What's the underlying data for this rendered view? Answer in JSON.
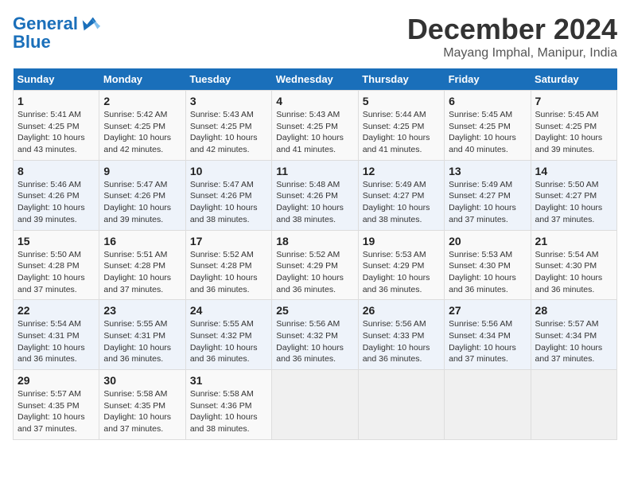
{
  "logo": {
    "line1": "General",
    "line2": "Blue"
  },
  "title": "December 2024",
  "location": "Mayang Imphal, Manipur, India",
  "weekdays": [
    "Sunday",
    "Monday",
    "Tuesday",
    "Wednesday",
    "Thursday",
    "Friday",
    "Saturday"
  ],
  "weeks": [
    [
      {
        "day": "1",
        "sunrise": "5:41 AM",
        "sunset": "4:25 PM",
        "daylight": "10 hours and 43 minutes."
      },
      {
        "day": "2",
        "sunrise": "5:42 AM",
        "sunset": "4:25 PM",
        "daylight": "10 hours and 42 minutes."
      },
      {
        "day": "3",
        "sunrise": "5:43 AM",
        "sunset": "4:25 PM",
        "daylight": "10 hours and 42 minutes."
      },
      {
        "day": "4",
        "sunrise": "5:43 AM",
        "sunset": "4:25 PM",
        "daylight": "10 hours and 41 minutes."
      },
      {
        "day": "5",
        "sunrise": "5:44 AM",
        "sunset": "4:25 PM",
        "daylight": "10 hours and 41 minutes."
      },
      {
        "day": "6",
        "sunrise": "5:45 AM",
        "sunset": "4:25 PM",
        "daylight": "10 hours and 40 minutes."
      },
      {
        "day": "7",
        "sunrise": "5:45 AM",
        "sunset": "4:25 PM",
        "daylight": "10 hours and 39 minutes."
      }
    ],
    [
      {
        "day": "8",
        "sunrise": "5:46 AM",
        "sunset": "4:26 PM",
        "daylight": "10 hours and 39 minutes."
      },
      {
        "day": "9",
        "sunrise": "5:47 AM",
        "sunset": "4:26 PM",
        "daylight": "10 hours and 39 minutes."
      },
      {
        "day": "10",
        "sunrise": "5:47 AM",
        "sunset": "4:26 PM",
        "daylight": "10 hours and 38 minutes."
      },
      {
        "day": "11",
        "sunrise": "5:48 AM",
        "sunset": "4:26 PM",
        "daylight": "10 hours and 38 minutes."
      },
      {
        "day": "12",
        "sunrise": "5:49 AM",
        "sunset": "4:27 PM",
        "daylight": "10 hours and 38 minutes."
      },
      {
        "day": "13",
        "sunrise": "5:49 AM",
        "sunset": "4:27 PM",
        "daylight": "10 hours and 37 minutes."
      },
      {
        "day": "14",
        "sunrise": "5:50 AM",
        "sunset": "4:27 PM",
        "daylight": "10 hours and 37 minutes."
      }
    ],
    [
      {
        "day": "15",
        "sunrise": "5:50 AM",
        "sunset": "4:28 PM",
        "daylight": "10 hours and 37 minutes."
      },
      {
        "day": "16",
        "sunrise": "5:51 AM",
        "sunset": "4:28 PM",
        "daylight": "10 hours and 37 minutes."
      },
      {
        "day": "17",
        "sunrise": "5:52 AM",
        "sunset": "4:28 PM",
        "daylight": "10 hours and 36 minutes."
      },
      {
        "day": "18",
        "sunrise": "5:52 AM",
        "sunset": "4:29 PM",
        "daylight": "10 hours and 36 minutes."
      },
      {
        "day": "19",
        "sunrise": "5:53 AM",
        "sunset": "4:29 PM",
        "daylight": "10 hours and 36 minutes."
      },
      {
        "day": "20",
        "sunrise": "5:53 AM",
        "sunset": "4:30 PM",
        "daylight": "10 hours and 36 minutes."
      },
      {
        "day": "21",
        "sunrise": "5:54 AM",
        "sunset": "4:30 PM",
        "daylight": "10 hours and 36 minutes."
      }
    ],
    [
      {
        "day": "22",
        "sunrise": "5:54 AM",
        "sunset": "4:31 PM",
        "daylight": "10 hours and 36 minutes."
      },
      {
        "day": "23",
        "sunrise": "5:55 AM",
        "sunset": "4:31 PM",
        "daylight": "10 hours and 36 minutes."
      },
      {
        "day": "24",
        "sunrise": "5:55 AM",
        "sunset": "4:32 PM",
        "daylight": "10 hours and 36 minutes."
      },
      {
        "day": "25",
        "sunrise": "5:56 AM",
        "sunset": "4:32 PM",
        "daylight": "10 hours and 36 minutes."
      },
      {
        "day": "26",
        "sunrise": "5:56 AM",
        "sunset": "4:33 PM",
        "daylight": "10 hours and 36 minutes."
      },
      {
        "day": "27",
        "sunrise": "5:56 AM",
        "sunset": "4:34 PM",
        "daylight": "10 hours and 37 minutes."
      },
      {
        "day": "28",
        "sunrise": "5:57 AM",
        "sunset": "4:34 PM",
        "daylight": "10 hours and 37 minutes."
      }
    ],
    [
      {
        "day": "29",
        "sunrise": "5:57 AM",
        "sunset": "4:35 PM",
        "daylight": "10 hours and 37 minutes."
      },
      {
        "day": "30",
        "sunrise": "5:58 AM",
        "sunset": "4:35 PM",
        "daylight": "10 hours and 37 minutes."
      },
      {
        "day": "31",
        "sunrise": "5:58 AM",
        "sunset": "4:36 PM",
        "daylight": "10 hours and 38 minutes."
      },
      null,
      null,
      null,
      null
    ]
  ]
}
